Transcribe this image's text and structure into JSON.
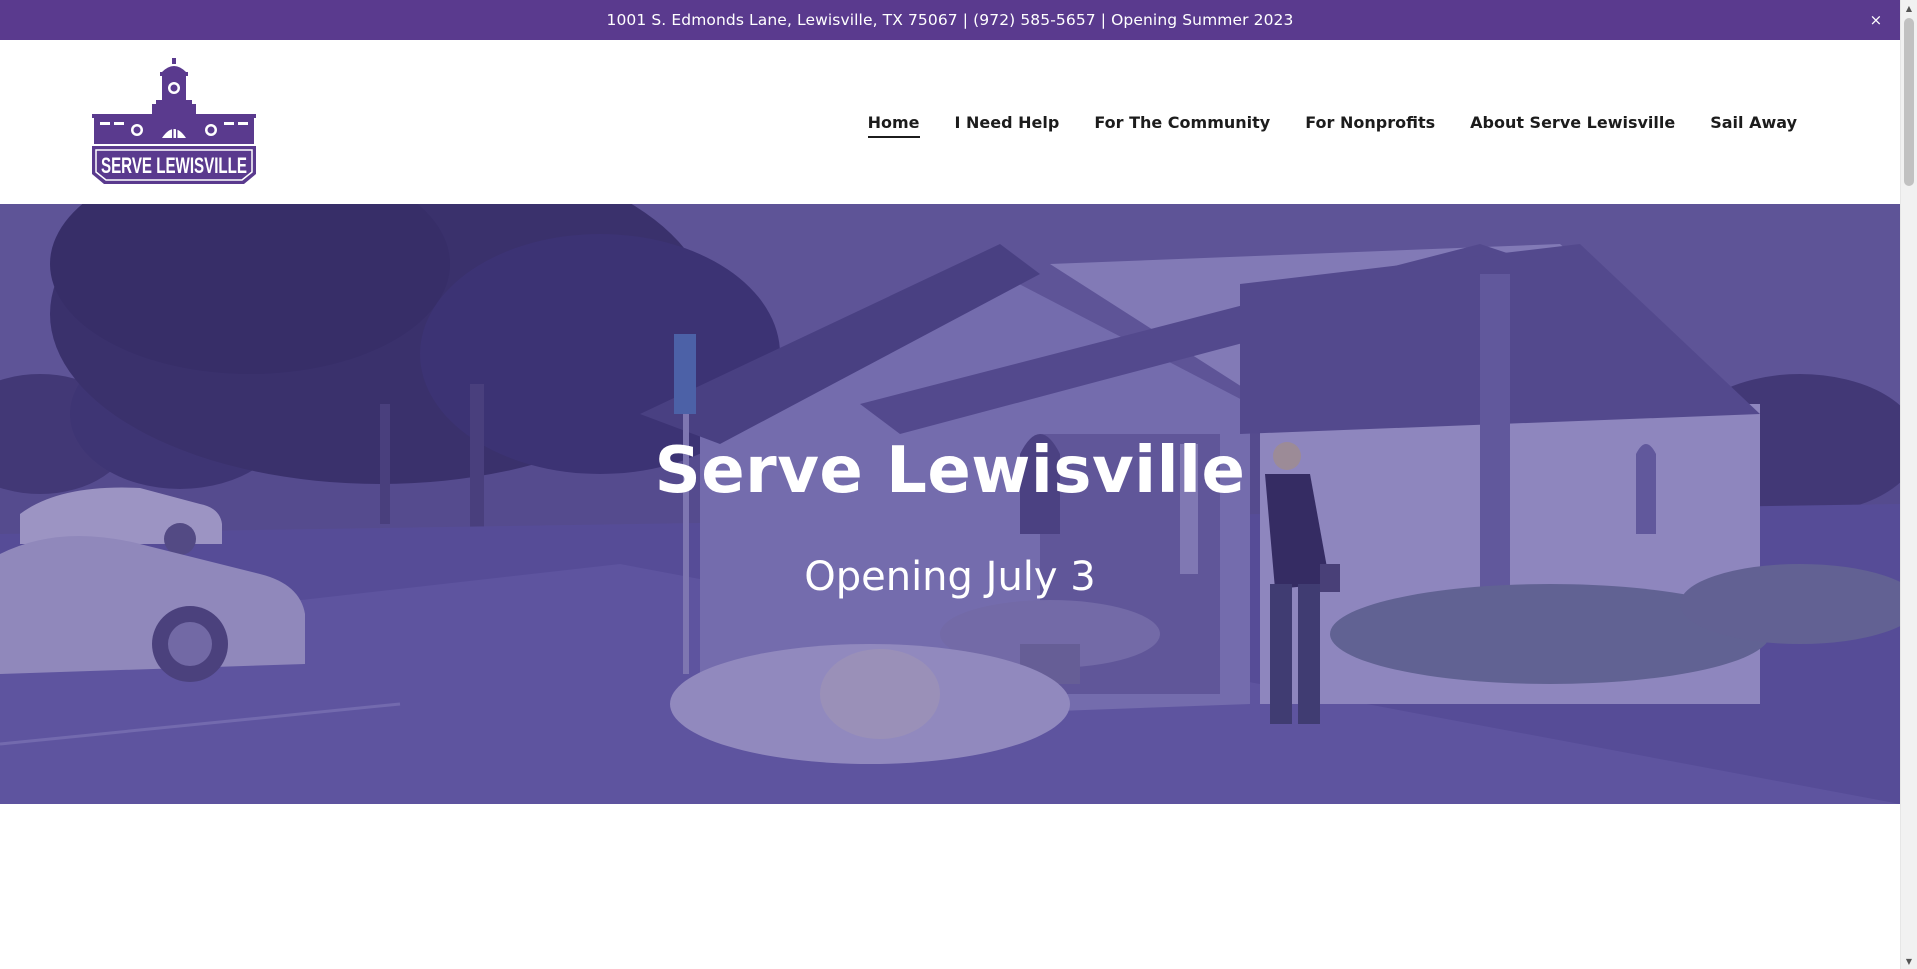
{
  "announcement": {
    "text": "1001 S. Edmonds Lane, Lewisville, TX 75067 | (972) 585-5657 | Opening Summer 2023",
    "close_label": "×"
  },
  "logo": {
    "text": "SERVE LEWISVILLE",
    "color": "#5a3a8e"
  },
  "nav": {
    "items": [
      {
        "label": "Home"
      },
      {
        "label": "I Need Help"
      },
      {
        "label": "For The Community"
      },
      {
        "label": "For Nonprofits"
      },
      {
        "label": "About Serve Lewisville"
      },
      {
        "label": "Sail Away"
      }
    ]
  },
  "hero": {
    "title": "Serve Lewisville",
    "subtitle": "Opening July 3"
  },
  "theme": {
    "brand_purple": "#5a3a8e",
    "text_dark": "#1c1c1c"
  }
}
